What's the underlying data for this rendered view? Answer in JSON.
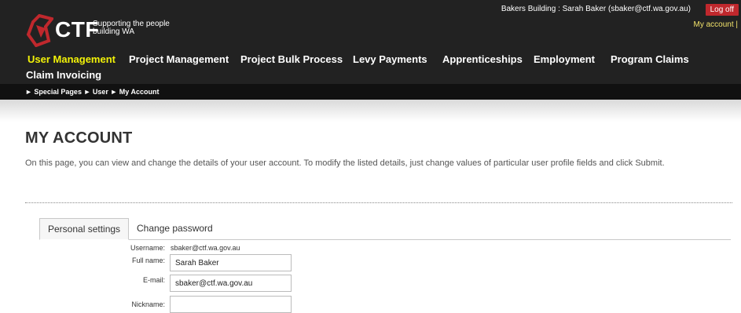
{
  "header": {
    "brand": "CTF",
    "tagline": "Supporting the people building WA",
    "user_info": "Bakers Building : Sarah Baker (sbaker@ctf.wa.gov.au)",
    "logoff_label": "Log off",
    "my_account_link": "My account |"
  },
  "nav": {
    "items": [
      {
        "label": "User Management"
      },
      {
        "label": "Project Management"
      },
      {
        "label": "Project Bulk Process"
      },
      {
        "label": "Levy Payments"
      },
      {
        "label": "Apprenticeships"
      },
      {
        "label": "Employment"
      },
      {
        "label": "Program Claims"
      },
      {
        "label": "Claim Invoicing"
      }
    ]
  },
  "breadcrumb": {
    "text": "► Special Pages ► User ► My Account"
  },
  "page": {
    "title": "MY ACCOUNT",
    "intro": "On this page, you can view and change the details of your user account. To modify the listed details, just change values of particular user profile fields and click Submit."
  },
  "tabs": {
    "personal": "Personal settings",
    "password": "Change password"
  },
  "form": {
    "username_label": "Username:",
    "username_value": "sbaker@ctf.wa.gov.au",
    "fullname_label": "Full name:",
    "fullname_value": "Sarah Baker",
    "email_label": "E-mail:",
    "email_value": "sbaker@ctf.wa.gov.au",
    "nickname_label": "Nickname:",
    "nickname_value": ""
  },
  "colors": {
    "header_bg": "#222222",
    "accent_red": "#c0282d",
    "active_nav": "#f2f208"
  }
}
